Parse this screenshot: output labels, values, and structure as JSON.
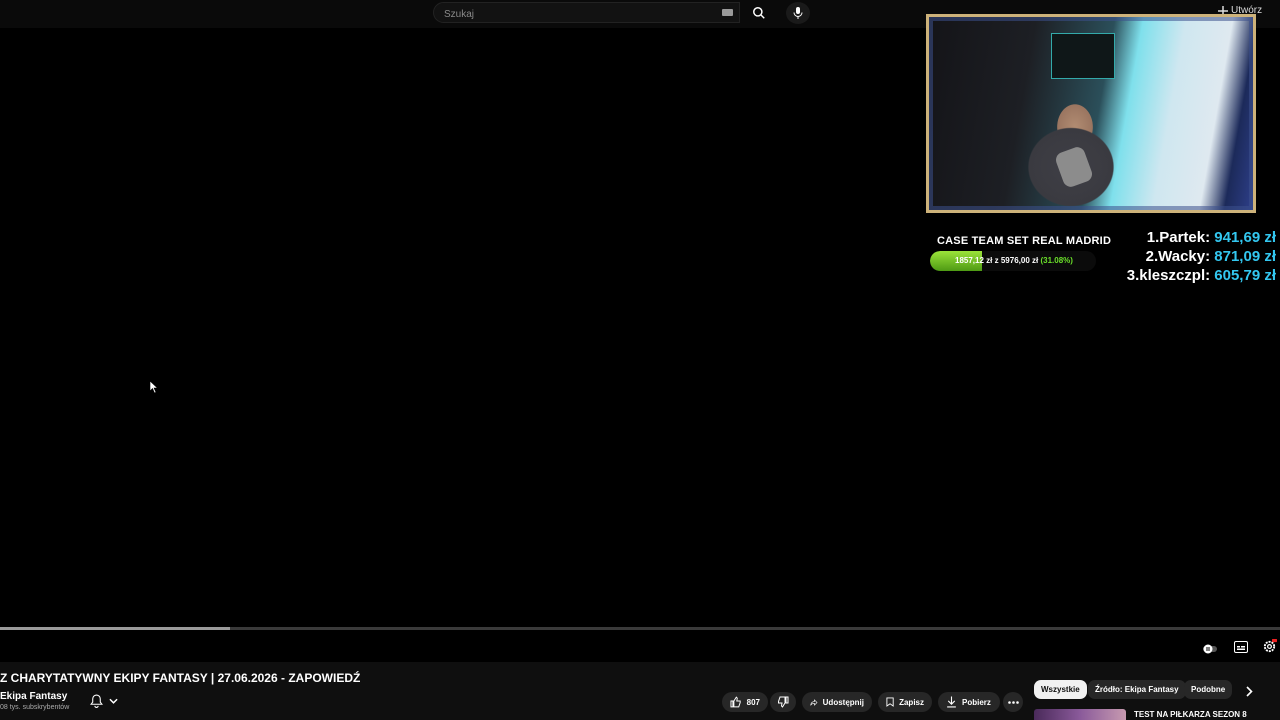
{
  "search": {
    "placeholder": "Szukaj"
  },
  "header": {
    "create_label": "Utwórz"
  },
  "overlay": {
    "goal_title": "CASE TEAM SET REAL MADRID",
    "goal_current": "1857,12 zł",
    "goal_sep": "z",
    "goal_target": "5976,00 zł",
    "goal_percent_text": "(31.08%)",
    "goal_fraction": 0.3108,
    "leaderboard": [
      {
        "name": "1.Partek:",
        "amount": "941,69 zł"
      },
      {
        "name": "2.Wacky:",
        "amount": "871,09 zł"
      },
      {
        "name": "3.kleszczpl:",
        "amount": "605,79 zł"
      }
    ],
    "accent_color": "#33c7f0",
    "goal_color": "#6be02a"
  },
  "player": {
    "progress_fraction": 0.18
  },
  "video": {
    "title": "Z CHARYTATYWNY EKIPY FANTASY | 27.06.2026 - ZAPOWIEDŹ",
    "channel": "Ekipa Fantasy",
    "subscribers": "08 tys. subskrybentów"
  },
  "actions": {
    "likes": "807",
    "share": "Udostępnij",
    "save": "Zapisz",
    "download": "Pobierz"
  },
  "chips": [
    "Wszystkie",
    "Źródło: Ekipa Fantasy",
    "Podobne"
  ],
  "suggested": {
    "title": "TEST NA PIŁKARZA SEZON 8"
  },
  "icons": [
    "search-icon",
    "mic-icon",
    "keyboard-icon",
    "plus-icon",
    "bell-icon",
    "chevron-down-icon",
    "like-icon",
    "dislike-icon",
    "share-icon",
    "save-icon",
    "download-icon",
    "more-icon",
    "chevron-right-icon",
    "autoplay-icon",
    "subtitles-icon",
    "settings-icon"
  ]
}
